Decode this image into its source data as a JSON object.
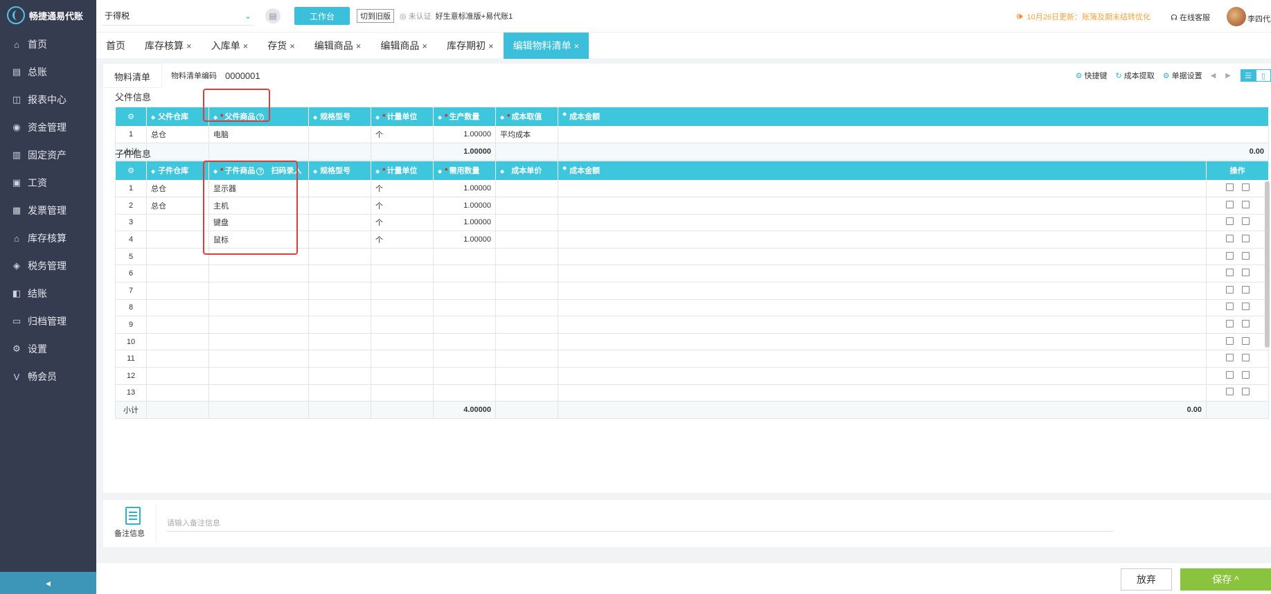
{
  "app": {
    "logo_text": "畅捷通易代账"
  },
  "sidebar": {
    "items": [
      {
        "label": "首页",
        "icon": "home-icon",
        "glyph": "⌂"
      },
      {
        "label": "总账",
        "icon": "ledger-icon",
        "glyph": "▤"
      },
      {
        "label": "报表中心",
        "icon": "report-chart-icon",
        "glyph": "◫"
      },
      {
        "label": "资金管理",
        "icon": "money-bag-icon",
        "glyph": "◉"
      },
      {
        "label": "固定资产",
        "icon": "asset-icon",
        "glyph": "▥"
      },
      {
        "label": "工资",
        "icon": "salary-icon",
        "glyph": "▣"
      },
      {
        "label": "发票管理",
        "icon": "invoice-icon",
        "glyph": "▦"
      },
      {
        "label": "库存核算",
        "icon": "warehouse-icon",
        "glyph": "⌂"
      },
      {
        "label": "税务管理",
        "icon": "tax-icon",
        "glyph": "◈"
      },
      {
        "label": "结账",
        "icon": "checkout-icon",
        "glyph": "◧"
      },
      {
        "label": "归档管理",
        "icon": "archive-icon",
        "glyph": "▭"
      },
      {
        "label": "设置",
        "icon": "gear-icon",
        "glyph": "⚙"
      },
      {
        "label": "畅会员",
        "icon": "member-v-icon",
        "glyph": "V"
      }
    ],
    "collapse_glyph": "◂"
  },
  "header": {
    "company": "于得税",
    "workbench_label": "工作台",
    "switch_old_label": "切到旧版",
    "auth_status": "未认证",
    "version": "好生意标准版+易代账1",
    "notice": "10月26日更新：账簿及期末结转优化",
    "support": "在线客服",
    "username": "李四代账"
  },
  "tabs": [
    {
      "label": "首页",
      "closable": false
    },
    {
      "label": "库存核算",
      "closable": true
    },
    {
      "label": "入库单",
      "closable": true
    },
    {
      "label": "存货",
      "closable": true
    },
    {
      "label": "编辑商品",
      "closable": true
    },
    {
      "label": "编辑商品",
      "closable": true
    },
    {
      "label": "库存期初",
      "closable": true
    },
    {
      "label": "编辑物料清单",
      "closable": true,
      "active": true
    }
  ],
  "bom": {
    "subtab": "物料清单",
    "code_label": "物料清单编码",
    "code_value": "0000001",
    "tools": {
      "shortcut": "快捷键",
      "cost_fetch": "成本提取",
      "doc_settings": "单据设置"
    }
  },
  "parent": {
    "title": "父件信息",
    "headers": {
      "warehouse": "父件仓库",
      "product": "父件商品",
      "spec": "规格型号",
      "unit": "计量单位",
      "qty": "生产数量",
      "cost_method": "成本取值",
      "amount": "成本金额"
    },
    "rows": [
      {
        "idx": "1",
        "warehouse": "总仓",
        "product": "电脑",
        "spec": "",
        "unit": "个",
        "qty": "1.00000",
        "cost_method": "平均成本",
        "amount": ""
      }
    ],
    "subtotal": {
      "label": "小计",
      "qty": "1.00000",
      "amount": "0.00"
    }
  },
  "child": {
    "title": "子件信息",
    "headers": {
      "warehouse": "子件仓库",
      "product": "子件商品",
      "scan": "扫码录入",
      "spec": "规格型号",
      "unit": "计量单位",
      "qty": "需用数量",
      "unit_cost": "成本单价",
      "amount": "成本金额",
      "ops": "操作"
    },
    "rows": [
      {
        "idx": "1",
        "warehouse": "总仓",
        "product": "显示器",
        "unit": "个",
        "qty": "1.00000"
      },
      {
        "idx": "2",
        "warehouse": "总仓",
        "product": "主机",
        "unit": "个",
        "qty": "1.00000"
      },
      {
        "idx": "3",
        "warehouse": "",
        "product": "键盘",
        "unit": "个",
        "qty": "1.00000"
      },
      {
        "idx": "4",
        "warehouse": "",
        "product": "鼠标",
        "unit": "个",
        "qty": "1.00000"
      },
      {
        "idx": "5",
        "warehouse": "",
        "product": "",
        "unit": "",
        "qty": ""
      },
      {
        "idx": "6",
        "warehouse": "",
        "product": "",
        "unit": "",
        "qty": ""
      },
      {
        "idx": "7",
        "warehouse": "",
        "product": "",
        "unit": "",
        "qty": ""
      },
      {
        "idx": "8",
        "warehouse": "",
        "product": "",
        "unit": "",
        "qty": ""
      },
      {
        "idx": "9",
        "warehouse": "",
        "product": "",
        "unit": "",
        "qty": ""
      },
      {
        "idx": "10",
        "warehouse": "",
        "product": "",
        "unit": "",
        "qty": ""
      },
      {
        "idx": "11",
        "warehouse": "",
        "product": "",
        "unit": "",
        "qty": ""
      },
      {
        "idx": "12",
        "warehouse": "",
        "product": "",
        "unit": "",
        "qty": ""
      },
      {
        "idx": "13",
        "warehouse": "",
        "product": "",
        "unit": "",
        "qty": ""
      }
    ],
    "subtotal": {
      "label": "小计",
      "qty": "4.00000",
      "amount": "0.00"
    }
  },
  "remarks": {
    "label": "备注信息",
    "placeholder": "请输入备注信息"
  },
  "footer": {
    "cancel_label": "放弃",
    "save_label": "保存 ^"
  },
  "colors": {
    "accent": "#3bbfda",
    "sidebar_bg": "#353c4f",
    "save_green": "#8ac43f",
    "highlight_red": "#e53935"
  }
}
